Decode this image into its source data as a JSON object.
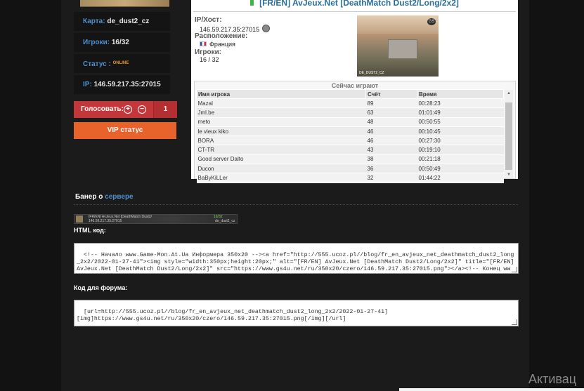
{
  "server_info": {
    "map_label": "Карта:",
    "map_value": "de_dust2_cz",
    "players_label": "Игроки:",
    "players_value": "16/32",
    "status_label": "Статус :",
    "status_value": "ONLINE",
    "ip_label": "IP:",
    "ip_value": "146.59.217.35:27015"
  },
  "vote": {
    "label": "Голосовать:",
    "plus": "+",
    "minus": "−",
    "count": "1"
  },
  "vip_button": "VIP статус",
  "panel": {
    "title": "[FR/EN] AvJeux.Net [DeathMatch Dust2/Long/2x2]",
    "ip_label": "IP/Хост:",
    "ip_value": "146.59.217.35:27015",
    "location_label": "Расположение:",
    "location_value": "Франция",
    "players_label": "Игроки:",
    "players_value": "16 / 32",
    "map_caption": "DE_DUST2_CZ",
    "map_badge": "GS"
  },
  "players_now": {
    "heading": "Сейчас играют",
    "columns": [
      "Имя игрока",
      "Счёт",
      "Время"
    ],
    "rows": [
      [
        "Mazal",
        "89",
        "00:28:23"
      ],
      [
        "Jml.be",
        "63",
        "01:01:49"
      ],
      [
        "meto",
        "48",
        "00:50:55"
      ],
      [
        "le vieux kiko",
        "46",
        "00:10:45"
      ],
      [
        "BORA",
        "46",
        "00:27:30"
      ],
      [
        "CT-TR",
        "43",
        "00:19:10"
      ],
      [
        "Good server Dalto",
        "38",
        "00:21:18"
      ],
      [
        "Ducon",
        "36",
        "00:50:49"
      ],
      [
        "BaByKiLLer",
        "32",
        "01:44:22"
      ]
    ]
  },
  "banner": {
    "title_prefix": "Банер о",
    "title_link": "сервере",
    "image_line1": "[FR/EN] AvJeux.Net [DeathMatch Dust2/",
    "image_line2": "146.59.217.35:27015",
    "image_right1": "16/32",
    "image_right2": "de_dust2_cz"
  },
  "html_code": {
    "label": "HTML код:",
    "value": "<!-- Начало www.Game-Mon.At.Ua Информера 350x20 --><a href=\"http://555.ucoz.pl//blog/fr_en_avjeux_net_deathmatch_dust2_long_2x2/2022-01-27-41\"><img style=\"width:350px;height:20px;\" alt=\"[FR/EN] AvJeux.Net [DeathMatch Dust2/Long/2x2]\" title=\"[FR/EN] AvJeux.Net [DeathMatch Dust2/Long/2x2]\" src=\"https://www.gs4u.net/ru/350x20/czero/146.59.217.35:27015.png\"></a><!-- Конец www.Game-Mon.At.Ua"
  },
  "forum_code": {
    "label": "Код для форума:",
    "value": "[url=http://555.ucoz.pl//blog/fr_en_avjeux_net_deathmatch_dust2_long_2x2/2022-01-27-41]\n[img]https://www.gs4u.net/ru/350x20/czero/146.59.217.35:27015.png[/img][/url]"
  },
  "watermark": "Активац"
}
